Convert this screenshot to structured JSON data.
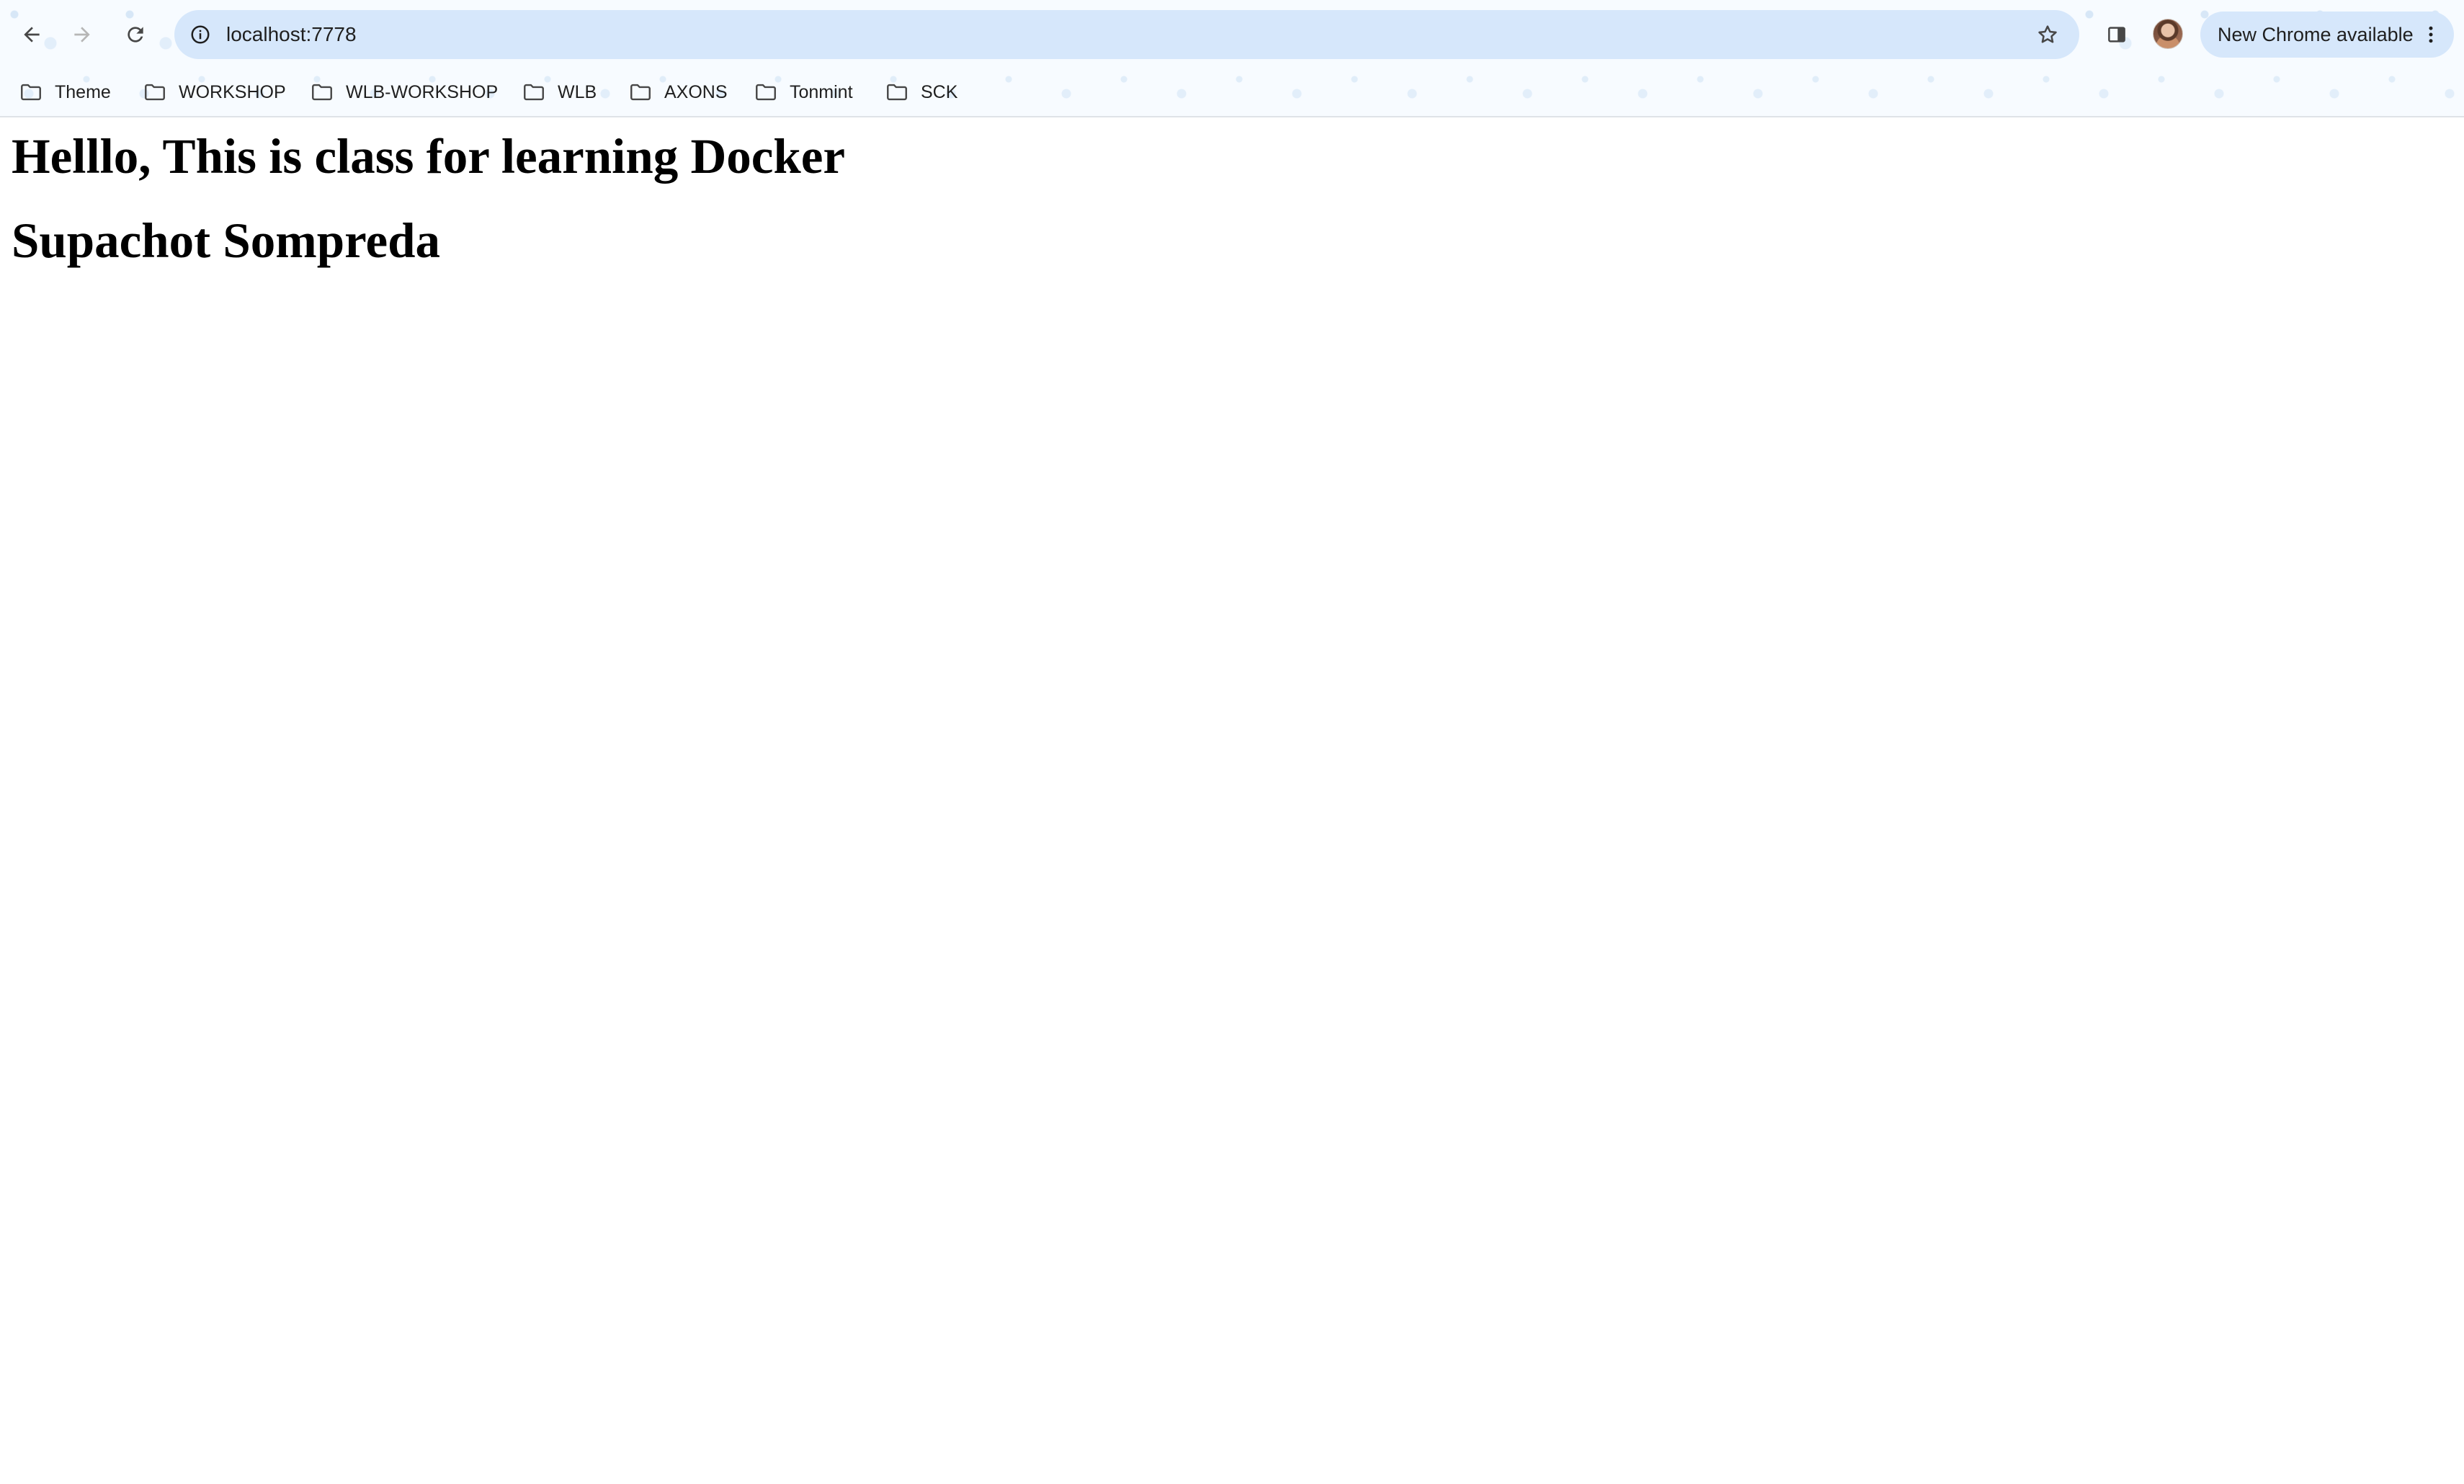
{
  "browser": {
    "address_bar": {
      "url": "localhost:7778"
    },
    "update_chip": {
      "label": "New Chrome available"
    },
    "bookmarks": [
      {
        "label": "Theme"
      },
      {
        "label": "WORKSHOP"
      },
      {
        "label": "WLB-WORKSHOP"
      },
      {
        "label": "WLB"
      },
      {
        "label": "AXONS"
      },
      {
        "label": "Tonmint"
      },
      {
        "label": "SCK"
      }
    ],
    "colors": {
      "omnibox_bg": "#d6e7fb",
      "chrome_bg": "#f7fbff"
    }
  },
  "page": {
    "headings": [
      {
        "text": "Helllo, This is class for learning Docker"
      },
      {
        "text": "Supachot Sompreda"
      }
    ]
  }
}
